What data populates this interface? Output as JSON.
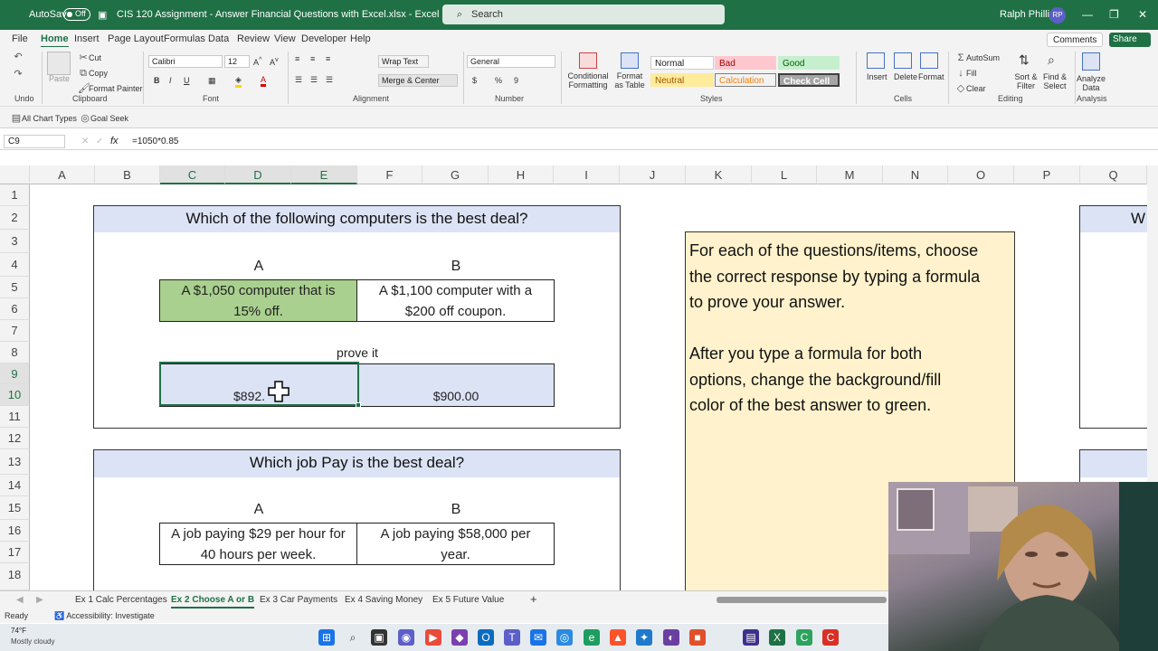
{
  "titlebar": {
    "autosave": "AutoSave",
    "toggle": "Off",
    "filename": "CIS 120 Assignment - Answer Financial Questions with Excel.xlsx - Excel",
    "search_placeholder": "Search",
    "user": "Ralph Phillips",
    "initials": "RP"
  },
  "menu": [
    "File",
    "Home",
    "Insert",
    "Page Layout",
    "Formulas",
    "Data",
    "Review",
    "View",
    "Developer",
    "Help"
  ],
  "comments": "Comments",
  "share": "Share",
  "ribbon": {
    "clipboard": {
      "paste": "Paste",
      "cut": "Cut",
      "copy": "Copy",
      "format_painter": "Format Painter",
      "label": "Clipboard",
      "undo_label": "Undo"
    },
    "font": {
      "name": "Calibri",
      "size": "12",
      "label": "Font"
    },
    "alignment": {
      "wrap": "Wrap Text",
      "merge": "Merge & Center",
      "label": "Alignment"
    },
    "number": {
      "format": "General",
      "label": "Number"
    },
    "styles": {
      "conditional": "Conditional Formatting",
      "format_table": "Format as Table",
      "normal": "Normal",
      "bad": "Bad",
      "good": "Good",
      "neutral": "Neutral",
      "calculation": "Calculation",
      "check": "Check Cell",
      "label": "Styles"
    },
    "cells": {
      "insert": "Insert",
      "delete": "Delete",
      "format": "Format",
      "label": "Cells"
    },
    "editing": {
      "autosum": "AutoSum",
      "fill": "Fill",
      "clear": "Clear",
      "sort": "Sort & Filter",
      "find": "Find & Select",
      "label": "Editing"
    },
    "analysis": {
      "analyze": "Analyze Data",
      "label": "Analysis"
    }
  },
  "qat": {
    "chart_types": "All Chart Types",
    "goal_seek": "Goal Seek"
  },
  "formula_bar": {
    "namebox": "C9",
    "fx": "fx",
    "formula": "=1050*0.85"
  },
  "columns": [
    "A",
    "B",
    "C",
    "D",
    "E",
    "F",
    "G",
    "H",
    "I",
    "J",
    "K",
    "L",
    "M",
    "N",
    "O",
    "P",
    "Q"
  ],
  "rows": [
    "1",
    "2",
    "3",
    "4",
    "5",
    "6",
    "7",
    "8",
    "9",
    "10",
    "11",
    "12",
    "13",
    "14",
    "15",
    "16",
    "17",
    "18"
  ],
  "sheet": {
    "q1": {
      "title": "Which of the following computers is the best deal?",
      "a": "A",
      "b": "B",
      "opt_a_1": "A $1,050 computer that is",
      "opt_a_2": "15% off.",
      "opt_b_1": "A $1,100 computer with a",
      "opt_b_2": "$200 off coupon.",
      "prove": "prove it",
      "ans_a": "$892.",
      "ans_b": "$900.00"
    },
    "q2": {
      "title": "Which job Pay is the best deal?",
      "a": "A",
      "b": "B",
      "opt_a_1": "A job paying $29 per hour for",
      "opt_a_2": "40 hours per week.",
      "opt_b_1": "A job paying $58,000 per",
      "opt_b_2": "year."
    },
    "note": [
      "For each of the questions/items, choose",
      "the correct response by typing a formula",
      "to prove your answer.",
      "",
      "After you type a formula for both",
      "options, change the background/fill",
      "color of the best answer to green."
    ],
    "right_peek": "W"
  },
  "tabs": [
    "Ex 1 Calc Percentages",
    "Ex 2 Choose A or B",
    "Ex 3 Car Payments",
    "Ex 4 Saving Money",
    "Ex 5 Future Value"
  ],
  "status": {
    "ready": "Ready",
    "accessibility": "Accessibility: Investigate"
  },
  "weather": {
    "temp": "74°F",
    "desc": "Mostly cloudy"
  },
  "colors": {
    "accent": "#1f7145",
    "green_fill": "#a9d08e",
    "header_fill": "#dbe3f5",
    "note_fill": "#fff2cc"
  }
}
